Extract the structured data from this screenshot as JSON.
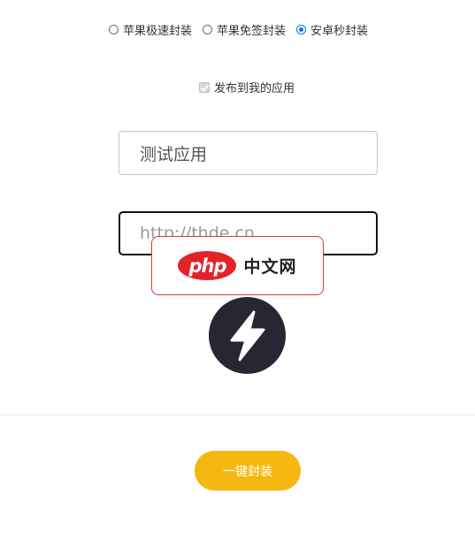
{
  "package_type": {
    "options": [
      {
        "label": "苹果极速封装",
        "selected": false
      },
      {
        "label": "苹果免签封装",
        "selected": false
      },
      {
        "label": "安卓秒封装",
        "selected": true
      }
    ]
  },
  "publish": {
    "label": "发布到我的应用",
    "checked": true,
    "disabled": true
  },
  "form": {
    "app_name_value": "测试应用",
    "url_value": "http://thde.cn"
  },
  "watermark": {
    "logo_text": "php",
    "site_name": "中文网"
  },
  "app_icon": "lightning-bolt-icon",
  "submit": {
    "label": "一键封装"
  },
  "colors": {
    "accent": "#f5b810",
    "radio_selected": "#0a75e6",
    "logo_red": "#e3222a",
    "icon_bg": "#262733"
  }
}
